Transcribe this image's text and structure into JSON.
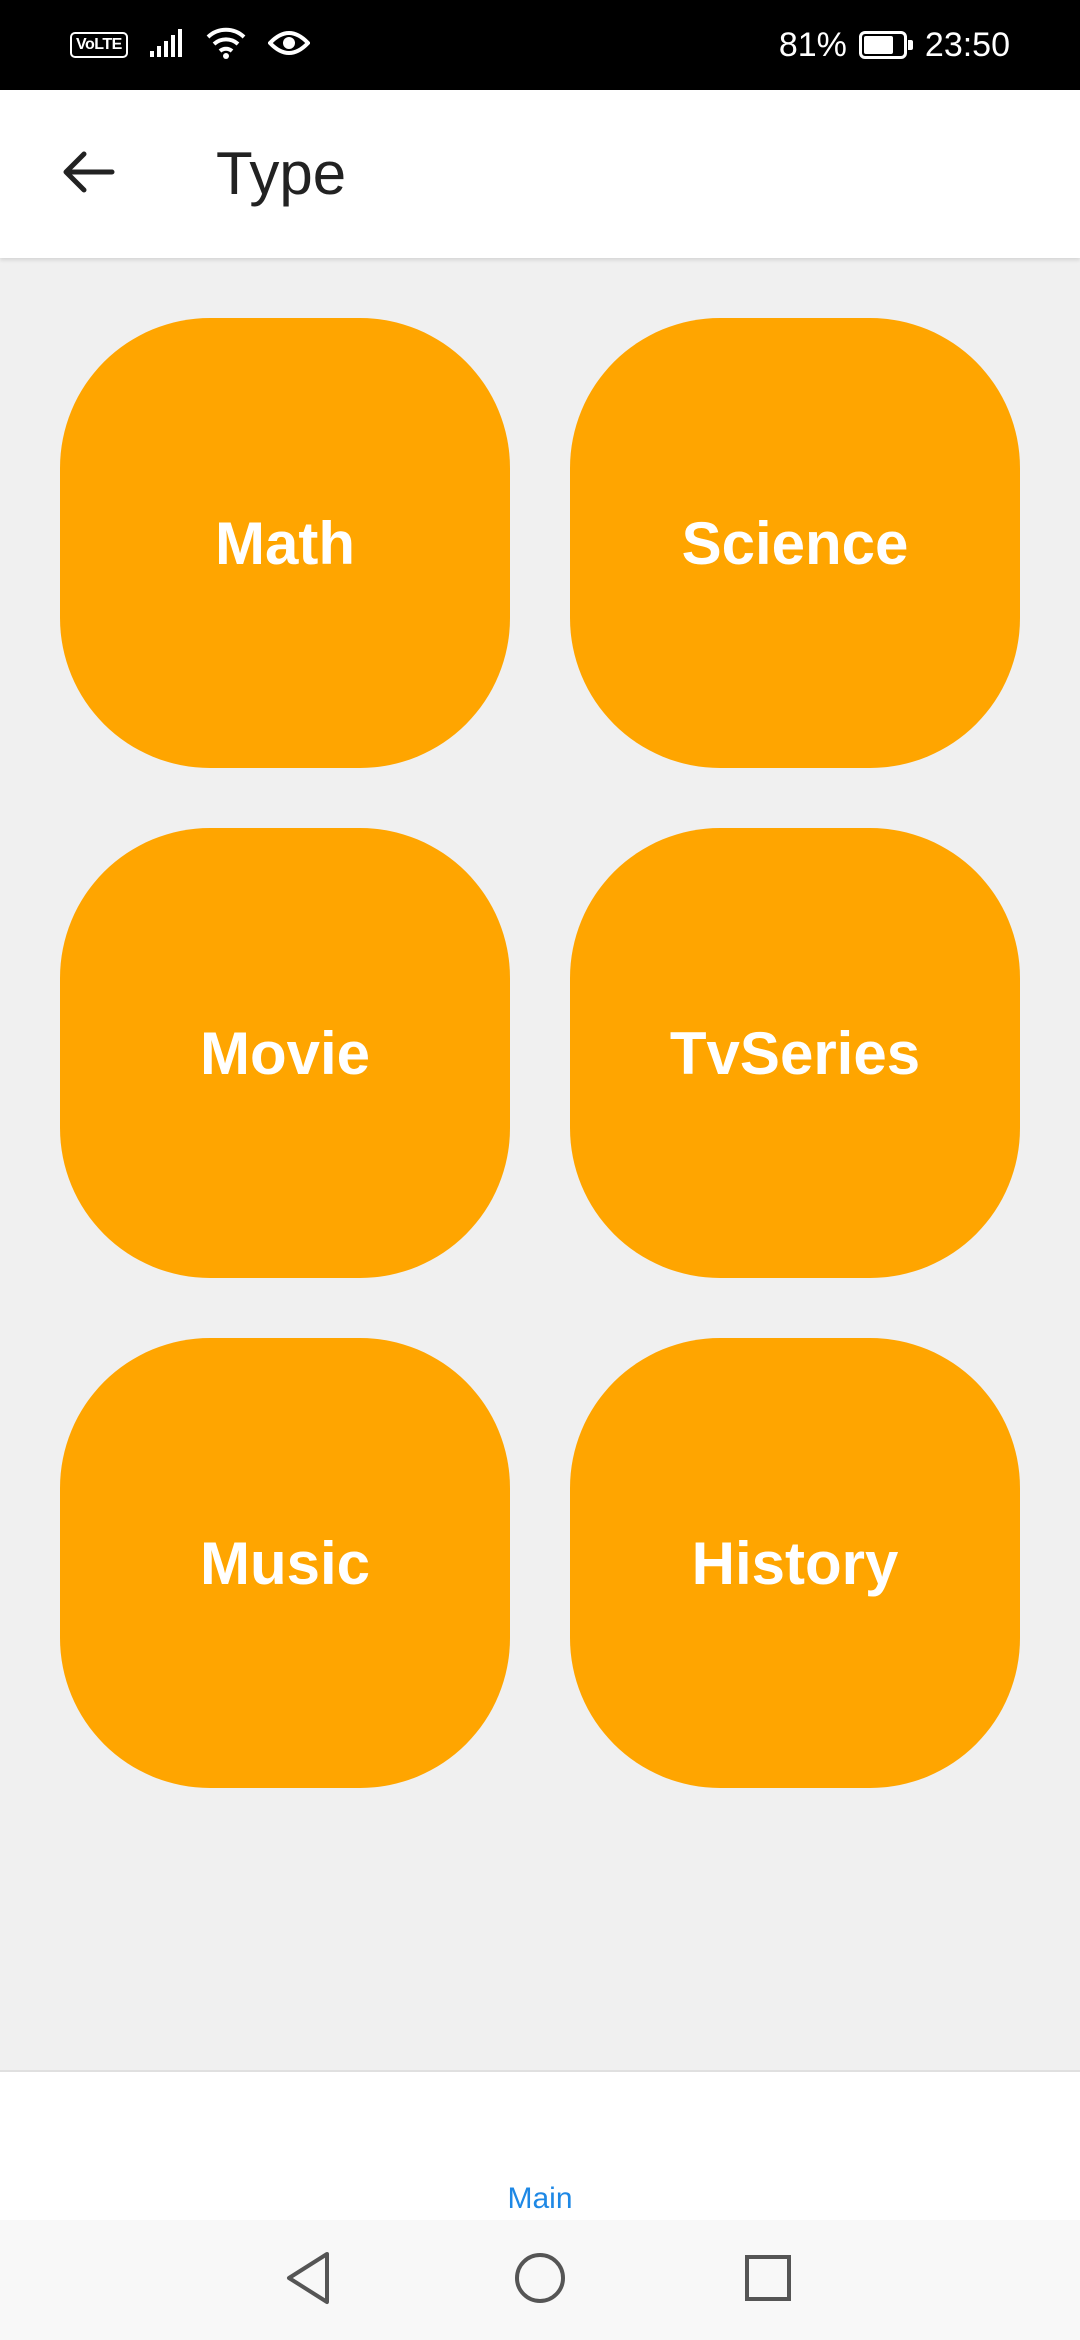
{
  "status_bar": {
    "volte": "VoLTE",
    "battery_percent": "81%",
    "battery_level": 0.81,
    "time": "23:50",
    "icons": [
      "signal-icon",
      "wifi-icon",
      "eye-icon",
      "battery-charging-icon"
    ]
  },
  "app_bar": {
    "title": "Type",
    "back_icon": "arrow-left-icon"
  },
  "categories": [
    {
      "label": "Math"
    },
    {
      "label": "Science"
    },
    {
      "label": "Movie"
    },
    {
      "label": "TvSeries"
    },
    {
      "label": "Music"
    },
    {
      "label": "History"
    }
  ],
  "bottom_nav": {
    "tab_label": "Main"
  },
  "system_nav": {
    "icons": [
      "back-triangle-icon",
      "home-circle-icon",
      "recents-square-icon"
    ]
  },
  "colors": {
    "tile": "#ffa500",
    "tile_text": "#ffffff",
    "background": "#f0f0f0",
    "accent": "#1e88e5"
  }
}
